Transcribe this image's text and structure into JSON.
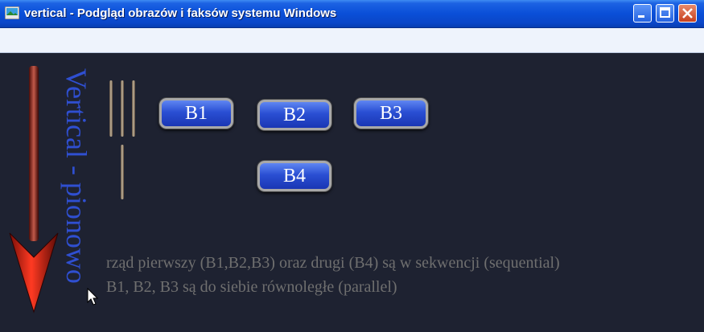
{
  "window": {
    "title": "vertical - Podgląd obrazów i faksów systemu Windows"
  },
  "slide": {
    "vertical_label": "Vertical - pionowo",
    "buttons": [
      "B1",
      "B2",
      "B3",
      "B4"
    ],
    "line1": "rząd pierwszy (B1,B2,B3) oraz drugi (B4) są w sekwencji (sequential)",
    "line2": "B1, B2, B3 są do siebie równoległe (parallel)"
  },
  "colors": {
    "arrow": "#c0231a",
    "label": "#2f4fd1",
    "button": "#2a4fd3"
  }
}
